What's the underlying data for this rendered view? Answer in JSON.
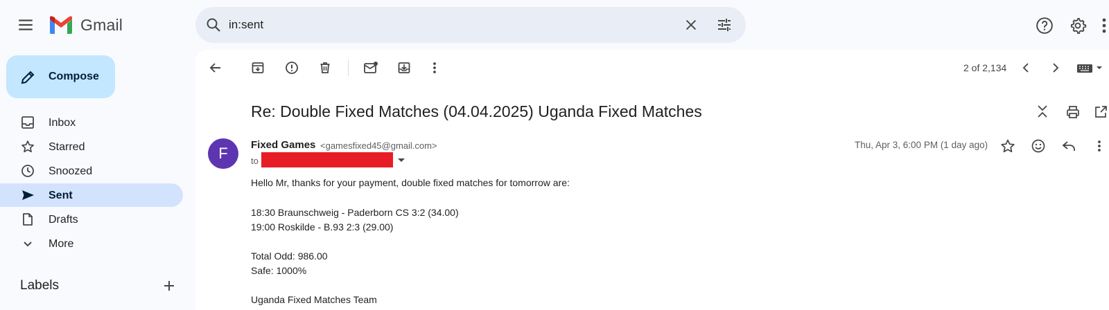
{
  "app": {
    "name": "Gmail"
  },
  "search": {
    "value": "in:sent"
  },
  "compose": {
    "label": "Compose"
  },
  "sidebar": {
    "items": [
      {
        "label": "Inbox",
        "icon": "inbox-icon"
      },
      {
        "label": "Starred",
        "icon": "star-icon"
      },
      {
        "label": "Snoozed",
        "icon": "clock-icon"
      },
      {
        "label": "Sent",
        "icon": "send-icon",
        "active": true
      },
      {
        "label": "Drafts",
        "icon": "draft-icon"
      },
      {
        "label": "More",
        "icon": "chevron-down-icon"
      }
    ],
    "labels_title": "Labels"
  },
  "toolbar": {
    "counter": "2 of 2,134"
  },
  "message": {
    "subject": "Re: Double Fixed Matches (04.04.2025) Uganda Fixed Matches",
    "avatar_letter": "F",
    "sender_name": "Fixed Games",
    "sender_email": "<gamesfixed45@gmail.com>",
    "to_label": "to",
    "date": "Thu, Apr 3, 6:00 PM (1 day ago)",
    "body": [
      "Hello Mr, thanks for your payment, double fixed matches for tomorrow are:",
      "18:30 Braunschweig - Paderborn CS 3:2 (34.00)",
      "19:00 Roskilde - B.93 2:3 (29.00)",
      "Total Odd: 986.00",
      "Safe: 1000%",
      "Uganda Fixed Matches Team"
    ]
  },
  "colors": {
    "compose_bg": "#c2e7ff",
    "active_nav_bg": "#d3e3fd",
    "avatar_bg": "#5e35b1",
    "redaction": "#e81c24"
  }
}
